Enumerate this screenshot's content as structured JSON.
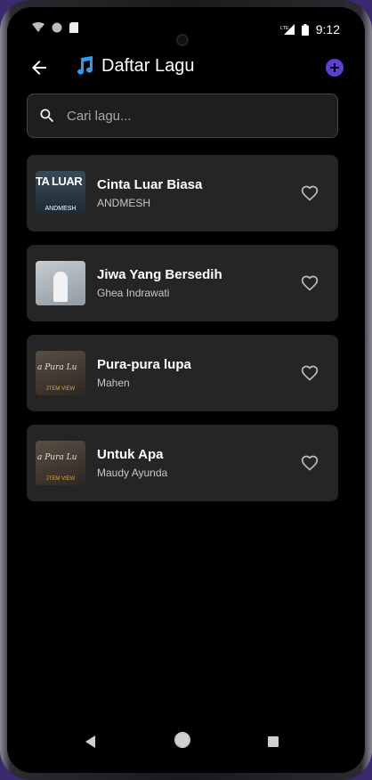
{
  "status_bar": {
    "time": "9:12",
    "network_label": "LTE",
    "icons": [
      "wifi-question-icon",
      "circle-icon",
      "sim-icon",
      "lte-signal-icon",
      "battery-icon"
    ]
  },
  "app_bar": {
    "title": "Daftar Lagu",
    "title_icon": "music-note-icon",
    "back_icon": "arrow-back-icon",
    "add_icon": "add-circle-icon",
    "accent_color": "#5b3fd6"
  },
  "search": {
    "placeholder": "Cari lagu...",
    "value": "",
    "icon": "search-icon"
  },
  "songs": [
    {
      "title": "Cinta Luar Biasa",
      "artist": "ANDMESH",
      "cover_text": "TA LUAR BIA",
      "cover_sub": "ANDMESH",
      "favorite": false
    },
    {
      "title": "Jiwa Yang Bersedih",
      "artist": "Ghea Indrawati",
      "favorite": false
    },
    {
      "title": "Pura-pura lupa",
      "artist": "Mahen",
      "cover_text": "a Pura Lu",
      "cover_sub": "JTEM VIEW",
      "favorite": false
    },
    {
      "title": "Untuk Apa",
      "artist": "Maudy Ayunda",
      "cover_text": "a Pura Lu",
      "cover_sub": "JTEM VIEW",
      "favorite": false
    }
  ],
  "nav_bar": {
    "icons": [
      "nav-back-icon",
      "nav-home-icon",
      "nav-recents-icon"
    ]
  }
}
